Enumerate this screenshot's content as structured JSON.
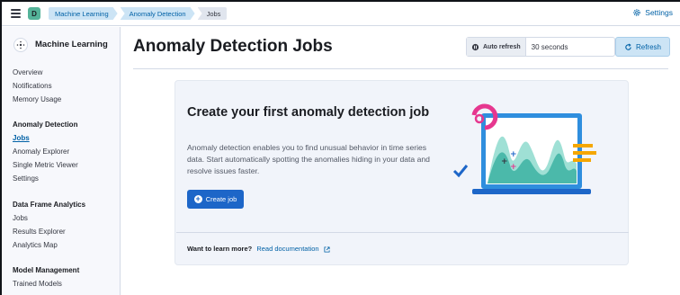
{
  "header": {
    "space_initial": "D",
    "breadcrumbs": [
      "Machine Learning",
      "Anomaly Detection",
      "Jobs"
    ],
    "settings_label": "Settings"
  },
  "sidebar": {
    "title": "Machine Learning",
    "top_items": [
      "Overview",
      "Notifications",
      "Memory Usage"
    ],
    "groups": [
      {
        "heading": "Anomaly Detection",
        "items": [
          "Jobs",
          "Anomaly Explorer",
          "Single Metric Viewer",
          "Settings"
        ]
      },
      {
        "heading": "Data Frame Analytics",
        "items": [
          "Jobs",
          "Results Explorer",
          "Analytics Map"
        ]
      },
      {
        "heading": "Model Management",
        "items": [
          "Trained Models"
        ]
      }
    ],
    "active_item": "Jobs"
  },
  "main": {
    "page_title": "Anomaly Detection Jobs",
    "auto_refresh_label": "Auto refresh",
    "auto_refresh_value": "30 seconds",
    "refresh_label": "Refresh"
  },
  "empty_state": {
    "title": "Create your first anomaly detection job",
    "description": "Anomaly detection enables you to find unusual behavior in time series data. Start automatically spotting the anomalies hiding in your data and resolve issues faster.",
    "create_button_label": "Create job",
    "learn_more_prefix": "Want to learn more?",
    "learn_more_link": "Read documentation"
  },
  "colors": {
    "accent_blue": "#1d66c8",
    "link_blue": "#0061a6",
    "breadcrumb_bg": "#cce4f5",
    "sidebar_bg": "#f7f8fc",
    "panel_bg": "#f1f4fa",
    "space_avatar": "#54b399"
  }
}
